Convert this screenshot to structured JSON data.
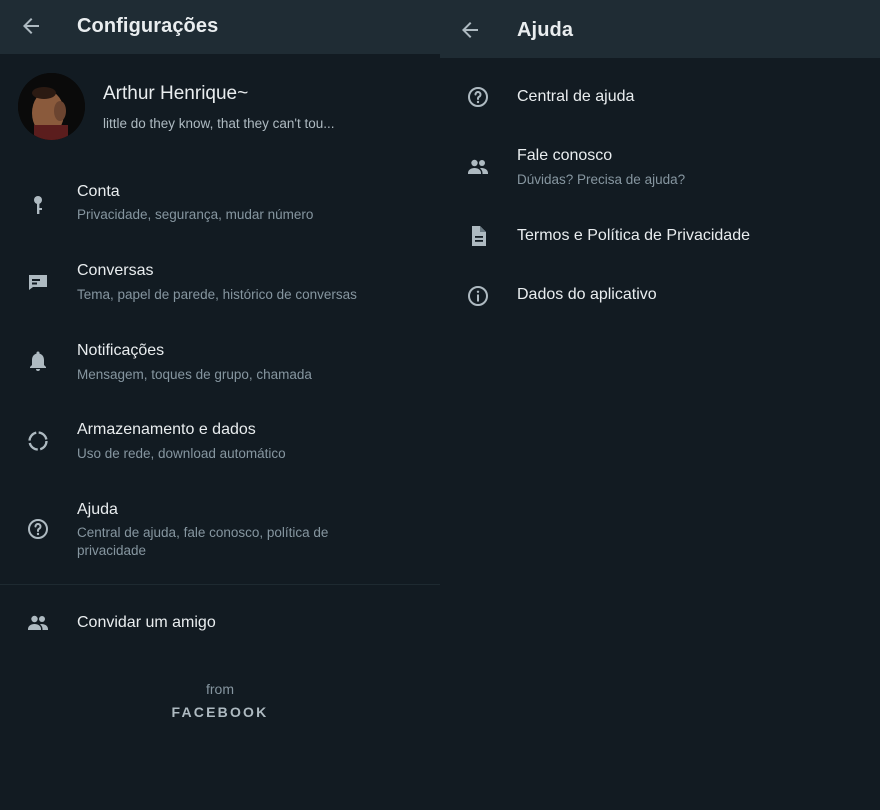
{
  "settings": {
    "title": "Configurações",
    "profile": {
      "name": "Arthur Henrique~",
      "status": "little do they know, that they can't tou..."
    },
    "items": [
      {
        "icon": "key-icon",
        "title": "Conta",
        "subtitle": "Privacidade, segurança, mudar número"
      },
      {
        "icon": "chat-icon",
        "title": "Conversas",
        "subtitle": "Tema, papel de parede, histórico de conversas"
      },
      {
        "icon": "bell-icon",
        "title": "Notificações",
        "subtitle": "Mensagem, toques de grupo, chamada"
      },
      {
        "icon": "storage-icon",
        "title": "Armazenamento e dados",
        "subtitle": "Uso de rede, download automático"
      },
      {
        "icon": "help-icon",
        "title": "Ajuda",
        "subtitle": "Central de ajuda, fale conosco, política de privacidade"
      }
    ],
    "invite": {
      "icon": "people-icon",
      "label": "Convidar um amigo"
    },
    "footer": {
      "from": "from",
      "brand": "FACEBOOK"
    }
  },
  "help": {
    "title": "Ajuda",
    "items": [
      {
        "icon": "help-icon",
        "title": "Central de ajuda",
        "subtitle": ""
      },
      {
        "icon": "people-icon",
        "title": "Fale conosco",
        "subtitle": "Dúvidas? Precisa de ajuda?"
      },
      {
        "icon": "document-icon",
        "title": "Termos e Política de Privacidade",
        "subtitle": ""
      },
      {
        "icon": "info-icon",
        "title": "Dados do aplicativo",
        "subtitle": ""
      }
    ]
  },
  "colors": {
    "background": "#121b22",
    "appbar": "#1f2c34",
    "primary_text": "#e9edef",
    "secondary_text": "#8696a0",
    "icon": "#aebac1"
  }
}
